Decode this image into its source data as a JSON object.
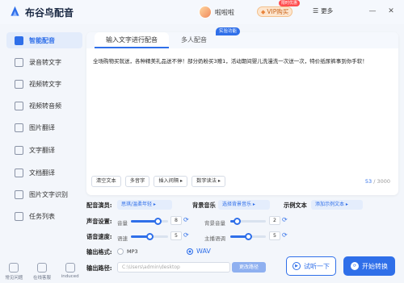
{
  "app": {
    "title": "布谷鸟配音"
  },
  "header": {
    "user_name": "啦啦啦",
    "vip_label": "VIP购买",
    "vip_badge": "限时优惠",
    "more_label": "更多",
    "minimize": "—",
    "close": "✕"
  },
  "sidebar": {
    "items": [
      {
        "label": "智能配音",
        "icon": "microphone-icon"
      },
      {
        "label": "录音转文字",
        "icon": "recording-icon"
      },
      {
        "label": "视频转文字",
        "icon": "video-icon"
      },
      {
        "label": "视频转音频",
        "icon": "video-audio-icon"
      },
      {
        "label": "图片翻译",
        "icon": "image-icon"
      },
      {
        "label": "文字翻译",
        "icon": "translate-icon"
      },
      {
        "label": "文档翻译",
        "icon": "document-icon"
      },
      {
        "label": "图片文字识别",
        "icon": "ocr-icon"
      },
      {
        "label": "任务列表",
        "icon": "list-icon"
      }
    ],
    "bottom": [
      {
        "label": "常见问题",
        "icon": "question-icon"
      },
      {
        "label": "在线客服",
        "icon": "support-icon"
      },
      {
        "label": "induced",
        "icon": "group-icon"
      }
    ]
  },
  "editor": {
    "tabs": [
      "输入文字进行配音",
      "多人配音"
    ],
    "lab_tag": "实验功能",
    "content": "全场购物买就送，各种精美礼品送不停！部分奶粉买3赠1，活动期间婴儿洗漫洗一次送一次，特价纸尿裤事到你手软！",
    "toolbar": [
      "清空文本",
      "多音字",
      "插入间隔 ▸",
      "数字读法 ▸"
    ],
    "count_current": "53",
    "count_total": "/ 3000"
  },
  "settings": {
    "voice_label": "配音演员:",
    "voice_value": "思琪/温柔年轻  ▸",
    "bgm_label": "背景音乐",
    "bgm_value": "选择背景音乐  ▸",
    "example_label": "示例文本",
    "example_value": "添加示例文本  ▸",
    "volume_label": "声音设置:",
    "volume_sub": "音量",
    "volume_value": "8",
    "volume_level": 0.72,
    "bg_volume_sub": "背景音量",
    "bg_volume_value": "2",
    "bg_volume_level": 0.18,
    "speed_label": "语音速度:",
    "speed_sub": "语速",
    "speed_value": "5",
    "speed_level": 0.5,
    "pitch_sub": "主播语调",
    "pitch_value": "5",
    "pitch_level": 0.5,
    "format_label": "输出格式:",
    "format_mp3": "MP3",
    "format_wav": "WAV",
    "path_label": "输出路径:",
    "path_value": "C:\\Users\\admin\\desktop",
    "path_button": "更改路径",
    "listen_button": "试听一下",
    "start_button": "开始转换"
  },
  "colors": {
    "accent": "#2f6fe9",
    "background": "#f3f6fb"
  }
}
